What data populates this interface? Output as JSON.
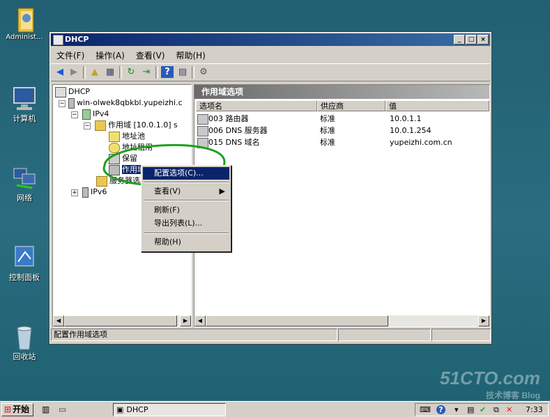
{
  "desktop": {
    "icons": [
      {
        "label": "Administ..."
      },
      {
        "label": "计算机"
      },
      {
        "label": "网络"
      },
      {
        "label": "控制面板"
      },
      {
        "label": "回收站"
      }
    ]
  },
  "window": {
    "title": "DHCP",
    "menu": [
      "文件(F)",
      "操作(A)",
      "查看(V)",
      "帮助(H)"
    ],
    "tree": {
      "root": "DHCP",
      "server": "win-olwek8qbkbl.yupeizhi.c",
      "ipv4": "IPv4",
      "scope": "作用域 [10.0.1.0] s",
      "address_pool": "地址池",
      "address_leases": "地址租用",
      "reservations": "保留",
      "scope_options": "作用域选项",
      "server_options": "服务器选项",
      "ipv6": "IPv6"
    },
    "pane_title": "作用域选项",
    "columns": [
      "选项名",
      "供应商",
      "值"
    ],
    "rows": [
      {
        "name": "003 路由器",
        "vendor": "标准",
        "value": "10.0.1.1"
      },
      {
        "name": "006 DNS 服务器",
        "vendor": "标准",
        "value": "10.0.1.254"
      },
      {
        "name": "015 DNS 域名",
        "vendor": "标准",
        "value": "yupeizhi.com.cn"
      }
    ],
    "status_text": "配置作用域选项"
  },
  "context_menu": {
    "configure": "配置选项(C)...",
    "view": "查看(V)",
    "refresh": "刷新(F)",
    "export": "导出列表(L)...",
    "help": "帮助(H)"
  },
  "taskbar": {
    "start": "开始",
    "task": "DHCP",
    "clock": "7:33"
  },
  "watermark": {
    "line1": "51CTO.com",
    "line2": "技术博客  Blog"
  }
}
